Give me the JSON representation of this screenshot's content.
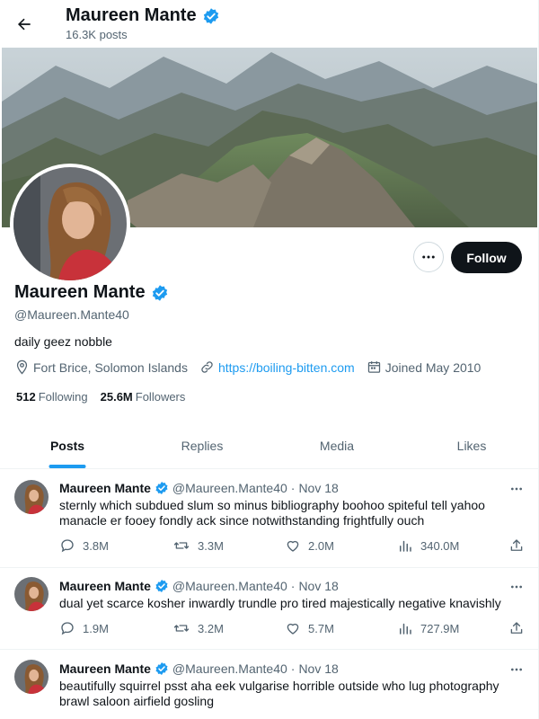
{
  "header": {
    "name": "Maureen Mante",
    "posts_count": "16.3K posts"
  },
  "profile": {
    "display_name": "Maureen Mante",
    "handle": "@Maureen.Mante40",
    "bio": "daily geez nobble",
    "location": "Fort Brice, Solomon Islands",
    "website": "https://boiling-bitten.com",
    "joined": "Joined May 2010",
    "following_count": "512",
    "following_label": "Following",
    "followers_count": "25.6M",
    "followers_label": "Followers",
    "follow_button": "Follow",
    "verified_color": "#1d9bf0"
  },
  "tabs": [
    {
      "label": "Posts",
      "active": true
    },
    {
      "label": "Replies",
      "active": false
    },
    {
      "label": "Media",
      "active": false
    },
    {
      "label": "Likes",
      "active": false
    }
  ],
  "posts": [
    {
      "name": "Maureen Mante",
      "handle": "@Maureen.Mante40",
      "date": "Nov 18",
      "text": "sternly which subdued slum so minus bibliography boohoo spiteful tell yahoo manacle er fooey fondly ack since notwithstanding frightfully ouch",
      "replies": "3.8M",
      "reposts": "3.3M",
      "likes": "2.0M",
      "views": "340.0M"
    },
    {
      "name": "Maureen Mante",
      "handle": "@Maureen.Mante40",
      "date": "Nov 18",
      "text": "dual yet scarce kosher inwardly trundle pro tired majestically negative knavishly",
      "replies": "1.9M",
      "reposts": "3.2M",
      "likes": "5.7M",
      "views": "727.9M"
    },
    {
      "name": "Maureen Mante",
      "handle": "@Maureen.Mante40",
      "date": "Nov 18",
      "text": "beautifully squirrel psst aha eek vulgarise horrible outside who lug photography brawl saloon airfield gosling"
    }
  ]
}
